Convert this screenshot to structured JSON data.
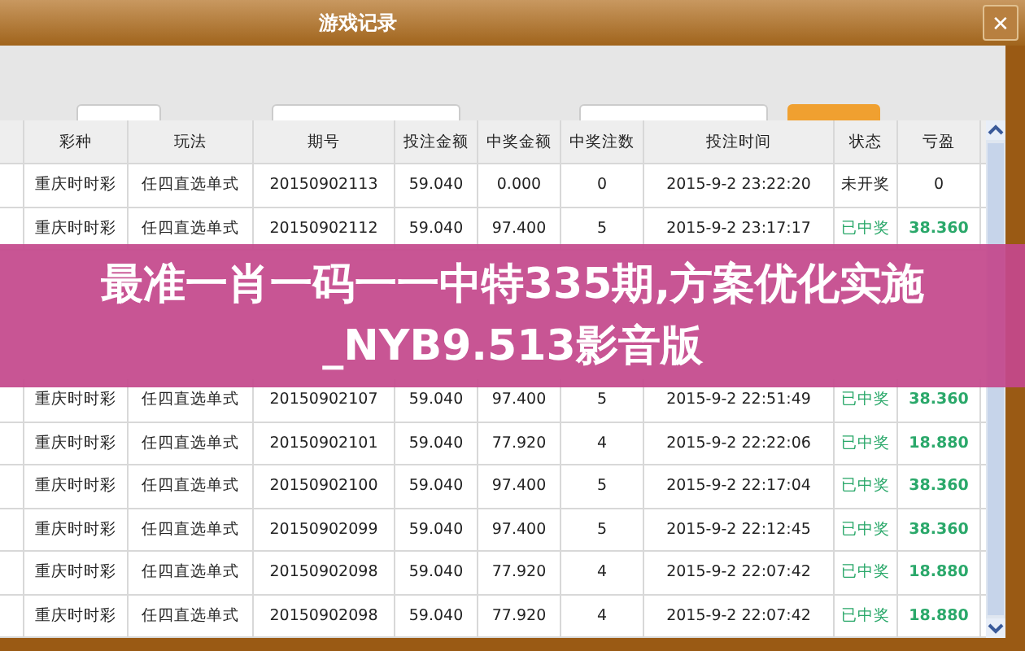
{
  "window": {
    "title": "游戏记录",
    "close": "✕"
  },
  "table": {
    "columns": [
      "彩种",
      "玩法",
      "期号",
      "投注金额",
      "中奖金额",
      "中奖注数",
      "投注时间",
      "状态",
      "亏盈"
    ],
    "rows": [
      {
        "cells": [
          "重庆时时彩",
          "任四直选单式",
          "20150902113",
          "59.040",
          "0.000",
          "0",
          "2015-9-2 23:22:20",
          "未开奖",
          "0"
        ],
        "won": false
      },
      {
        "cells": [
          "重庆时时彩",
          "任四直选单式",
          "20150902112",
          "59.040",
          "97.400",
          "5",
          "2015-9-2 23:17:17",
          "已中奖",
          "38.360"
        ],
        "won": true
      },
      {
        "cells": [
          "重庆时时彩",
          "任四直选单式",
          "20150902107",
          "59.040",
          "97.400",
          "5",
          "2015-9-2 22:51:49",
          "已中奖",
          "38.360"
        ],
        "won": true
      },
      {
        "cells": [
          "重庆时时彩",
          "任四直选单式",
          "20150902101",
          "59.040",
          "77.920",
          "4",
          "2015-9-2 22:22:06",
          "已中奖",
          "18.880"
        ],
        "won": true
      },
      {
        "cells": [
          "重庆时时彩",
          "任四直选单式",
          "20150902100",
          "59.040",
          "97.400",
          "5",
          "2015-9-2 22:17:04",
          "已中奖",
          "38.360"
        ],
        "won": true
      },
      {
        "cells": [
          "重庆时时彩",
          "任四直选单式",
          "20150902099",
          "59.040",
          "97.400",
          "5",
          "2015-9-2 22:12:45",
          "已中奖",
          "38.360"
        ],
        "won": true
      },
      {
        "cells": [
          "重庆时时彩",
          "任四直选单式",
          "20150902098",
          "59.040",
          "77.920",
          "4",
          "2015-9-2 22:07:42",
          "已中奖",
          "18.880"
        ],
        "won": true
      },
      {
        "cells": [
          "重庆时时彩",
          "任四直选单式",
          "20150902098",
          "59.040",
          "77.920",
          "4",
          "2015-9-2 22:07:42",
          "已中奖",
          "18.880"
        ],
        "won": true
      }
    ]
  },
  "banner": {
    "text": "最准一肖一码一一中特335期,方案优化实施_NYB9.513影音版"
  }
}
